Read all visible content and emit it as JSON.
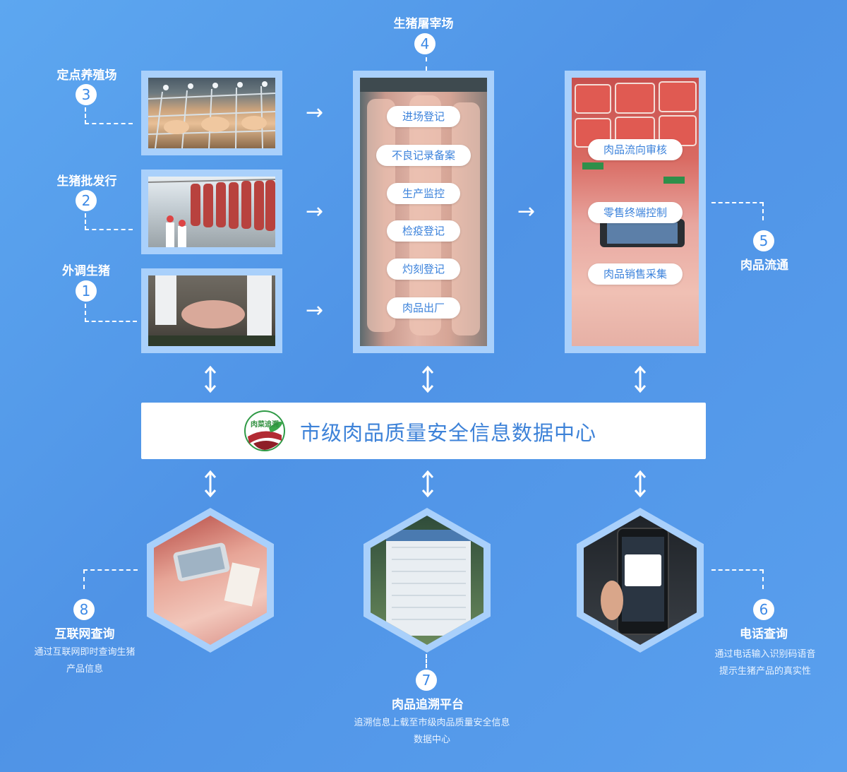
{
  "sources": [
    {
      "num": "3",
      "title": "定点养殖场"
    },
    {
      "num": "2",
      "title": "生猪批发行"
    },
    {
      "num": "1",
      "title": "外调生猪"
    }
  ],
  "slaughter": {
    "num": "4",
    "title": "生猪屠宰场",
    "steps": [
      "进场登记",
      "不良记录备案",
      "生产监控",
      "检疫登记",
      "灼刻登记",
      "肉品出厂"
    ]
  },
  "circulation": {
    "num": "5",
    "title": "肉品流通",
    "steps": [
      "肉品流向审核",
      "零售终端控制",
      "肉品销售采集"
    ]
  },
  "center": {
    "title": "市级肉品质量安全信息数据中心",
    "logo_text": "肉菜追溯"
  },
  "queries": [
    {
      "num": "8",
      "title": "互联网查询",
      "desc_lines": [
        "通过互联网即时查询生猪",
        "产品信息"
      ]
    },
    {
      "num": "7",
      "title": "肉品追溯平台",
      "desc_lines": [
        "追溯信息上载至市级肉品质量安全信息",
        "数据中心"
      ]
    },
    {
      "num": "6",
      "title": "电话查询",
      "desc_lines": [
        "通过电话输入识别码语音",
        "提示生猪产品的真实性"
      ]
    }
  ],
  "arrow_glyph": "→",
  "colors": {
    "accent": "#3d82d8",
    "frame": "#a9d0fb",
    "background": "#5aa0ee"
  }
}
